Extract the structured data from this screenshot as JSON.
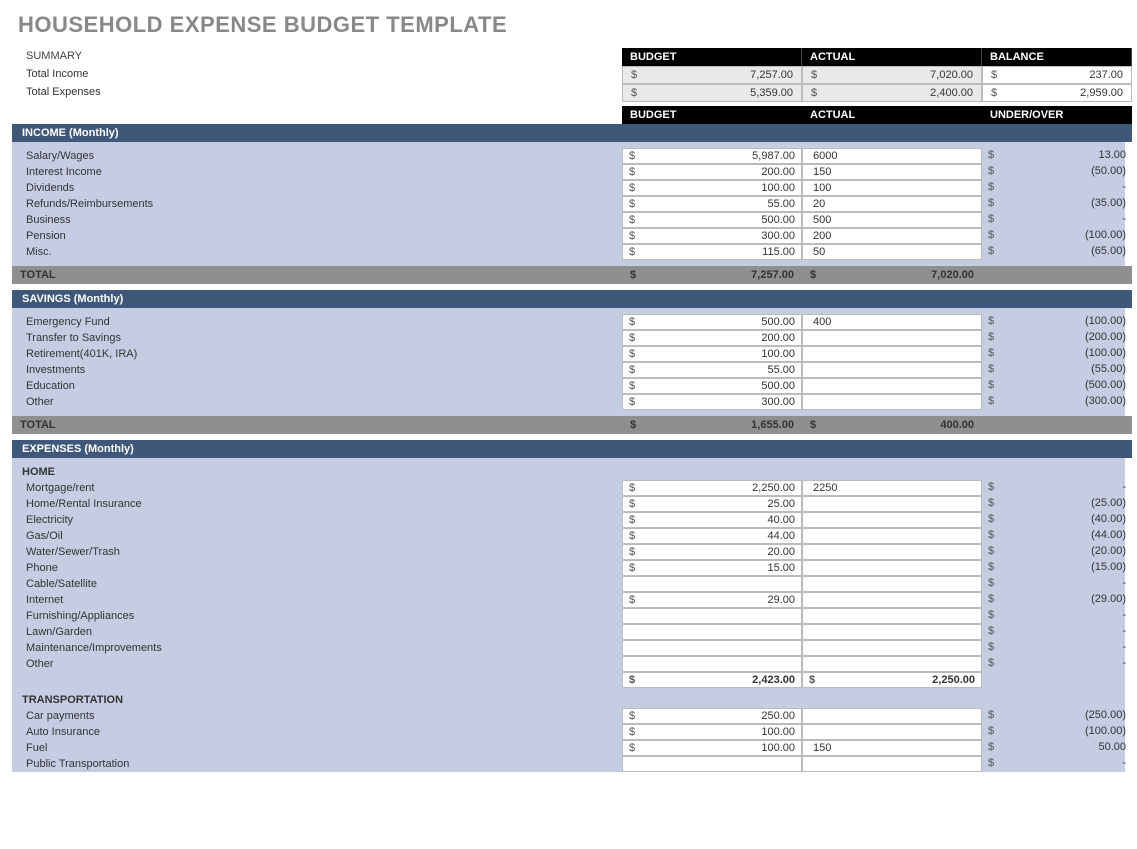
{
  "title": "HOUSEHOLD EXPENSE BUDGET TEMPLATE",
  "summary": {
    "label": "SUMMARY",
    "headers": [
      "BUDGET",
      "ACTUAL",
      "BALANCE"
    ],
    "rows": [
      {
        "label": "Total Income",
        "budget": "7,257.00",
        "actual": "7,020.00",
        "balance": "237.00"
      },
      {
        "label": "Total Expenses",
        "budget": "5,359.00",
        "actual": "2,400.00",
        "balance": "2,959.00"
      }
    ]
  },
  "colHeaders": [
    "BUDGET",
    "ACTUAL",
    "UNDER/OVER"
  ],
  "sections": [
    {
      "title": "INCOME (Monthly)",
      "rows": [
        {
          "name": "Salary/Wages",
          "budget": "5,987.00",
          "actual": "6000",
          "over": "13.00"
        },
        {
          "name": "Interest Income",
          "budget": "200.00",
          "actual": "150",
          "over": "(50.00)"
        },
        {
          "name": "Dividends",
          "budget": "100.00",
          "actual": "100",
          "over": "-"
        },
        {
          "name": "Refunds/Reimbursements",
          "budget": "55.00",
          "actual": "20",
          "over": "(35.00)"
        },
        {
          "name": "Business",
          "budget": "500.00",
          "actual": "500",
          "over": "-"
        },
        {
          "name": "Pension",
          "budget": "300.00",
          "actual": "200",
          "over": "(100.00)"
        },
        {
          "name": "Misc.",
          "budget": "115.00",
          "actual": "50",
          "over": "(65.00)"
        }
      ],
      "total": {
        "label": "TOTAL",
        "budget": "7,257.00",
        "actual": "7,020.00"
      }
    },
    {
      "title": "SAVINGS (Monthly)",
      "rows": [
        {
          "name": "Emergency Fund",
          "budget": "500.00",
          "actual": "400",
          "over": "(100.00)"
        },
        {
          "name": "Transfer to Savings",
          "budget": "200.00",
          "actual": "",
          "over": "(200.00)"
        },
        {
          "name": "Retirement(401K, IRA)",
          "budget": "100.00",
          "actual": "",
          "over": "(100.00)"
        },
        {
          "name": "Investments",
          "budget": "55.00",
          "actual": "",
          "over": "(55.00)"
        },
        {
          "name": "Education",
          "budget": "500.00",
          "actual": "",
          "over": "(500.00)"
        },
        {
          "name": "Other",
          "budget": "300.00",
          "actual": "",
          "over": "(300.00)"
        }
      ],
      "total": {
        "label": "TOTAL",
        "budget": "1,655.00",
        "actual": "400.00"
      }
    },
    {
      "title": "EXPENSES (Monthly)",
      "groups": [
        {
          "name": "HOME",
          "rows": [
            {
              "name": "Mortgage/rent",
              "budget": "2,250.00",
              "actual": "2250",
              "over": "-"
            },
            {
              "name": "Home/Rental Insurance",
              "budget": "25.00",
              "actual": "",
              "over": "(25.00)"
            },
            {
              "name": "Electricity",
              "budget": "40.00",
              "actual": "",
              "over": "(40.00)"
            },
            {
              "name": "Gas/Oil",
              "budget": "44.00",
              "actual": "",
              "over": "(44.00)"
            },
            {
              "name": "Water/Sewer/Trash",
              "budget": "20.00",
              "actual": "",
              "over": "(20.00)"
            },
            {
              "name": "Phone",
              "budget": "15.00",
              "actual": "",
              "over": "(15.00)"
            },
            {
              "name": "Cable/Satellite",
              "budget": "",
              "actual": "",
              "over": "-"
            },
            {
              "name": "Internet",
              "budget": "29.00",
              "actual": "",
              "over": "(29.00)"
            },
            {
              "name": "Furnishing/Appliances",
              "budget": "",
              "actual": "",
              "over": "-"
            },
            {
              "name": "Lawn/Garden",
              "budget": "",
              "actual": "",
              "over": "-"
            },
            {
              "name": "Maintenance/Improvements",
              "budget": "",
              "actual": "",
              "over": "-"
            },
            {
              "name": "Other",
              "budget": "",
              "actual": "",
              "over": "-"
            }
          ],
          "subtotal": {
            "budget": "2,423.00",
            "actual": "2,250.00"
          }
        },
        {
          "name": "TRANSPORTATION",
          "rows": [
            {
              "name": "Car payments",
              "budget": "250.00",
              "actual": "",
              "over": "(250.00)"
            },
            {
              "name": "Auto Insurance",
              "budget": "100.00",
              "actual": "",
              "over": "(100.00)"
            },
            {
              "name": "Fuel",
              "budget": "100.00",
              "actual": "150",
              "over": "50.00"
            },
            {
              "name": "Public Transportation",
              "budget": "",
              "actual": "",
              "over": "-"
            }
          ]
        }
      ]
    }
  ]
}
